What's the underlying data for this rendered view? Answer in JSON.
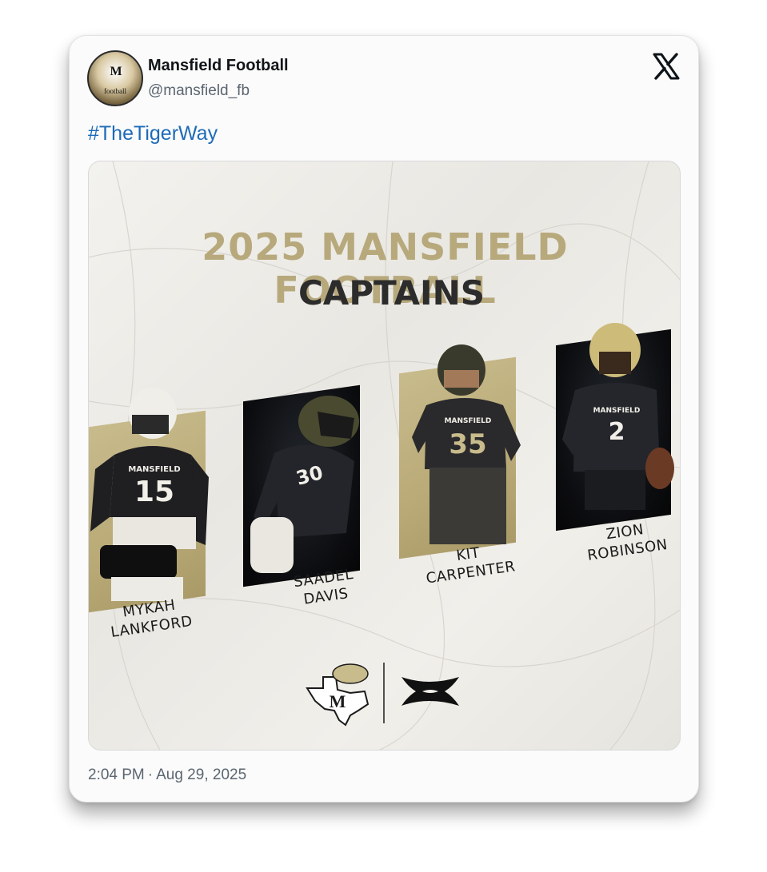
{
  "tweet": {
    "author_name": "Mansfield Football",
    "author_handle": "@mansfield_fb",
    "avatar_text": "football",
    "avatar_letter": "M",
    "hashtag": "#TheTigerWay",
    "time": "2:04 PM",
    "separator": "·",
    "date": "Aug 29, 2025"
  },
  "graphic": {
    "title_line1": "2025 MANSFIELD FOOTBALL",
    "title_line2": "CAPTAINS",
    "captains": [
      {
        "first": "MYKAH",
        "last": "LANKFORD",
        "number": "15"
      },
      {
        "first": "SAADEL",
        "last": "DAVIS",
        "number": "30"
      },
      {
        "first": "KIT",
        "last": "CARPENTER",
        "number": "35"
      },
      {
        "first": "ZION",
        "last": "ROBINSON",
        "number": "2"
      }
    ],
    "jersey_text": "MANSFIELD",
    "logo_letter": "M"
  },
  "colors": {
    "gold": "#b7a97c",
    "dark": "#2c2c2c",
    "link": "#1d6bb8",
    "muted": "#5b6670"
  },
  "icons": [
    "x-logo-icon",
    "tiger-texas-logo-icon",
    "under-armour-logo-icon"
  ]
}
